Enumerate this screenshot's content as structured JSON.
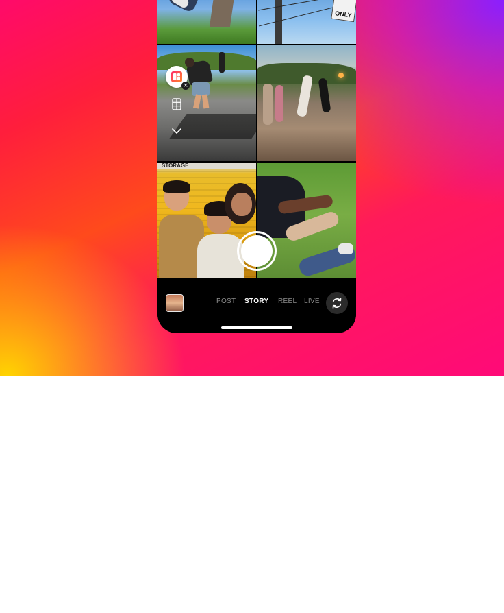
{
  "camera": {
    "modes": [
      {
        "label": "POST",
        "active": false
      },
      {
        "label": "STORY",
        "active": true
      },
      {
        "label": "REEL",
        "active": false
      },
      {
        "label": "LIVE",
        "active": false
      }
    ],
    "photos": [
      {
        "sign_text": "ONLY"
      },
      {
        "banner_text": "STORAGE"
      }
    ],
    "icons": {
      "layout": "layout-icon",
      "grid": "grid-icon",
      "collapse": "chevron-down-icon",
      "capture": "shutter-button",
      "gallery": "gallery-thumbnail",
      "flip": "flip-camera-icon"
    },
    "colors": {
      "gradient_pink": "#ff0a6a",
      "gradient_orange": "#ff4a1c",
      "gradient_yellow": "#ffd400",
      "gradient_purple": "#8a1fff",
      "inactive_mode": "#8c8c8c",
      "active_mode": "#ffffff"
    }
  }
}
